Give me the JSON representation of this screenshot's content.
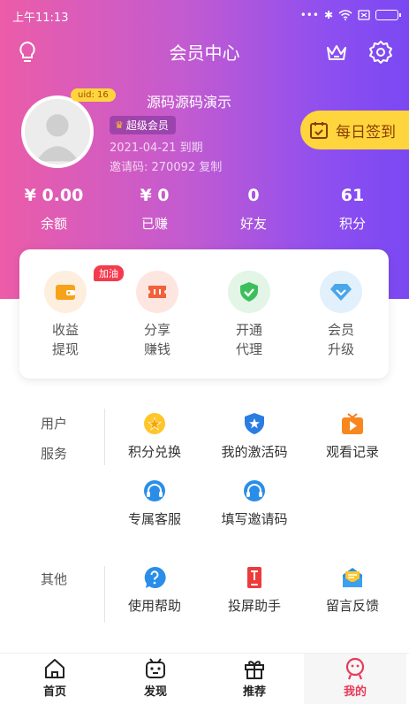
{
  "status_bar": {
    "time": "上午11:13",
    "icons": [
      "signal-dots-icon",
      "bluetooth-icon",
      "wifi-icon",
      "sim-icon",
      "battery-icon"
    ]
  },
  "nav": {
    "title": "会员中心",
    "left_icon": "lightbulb-icon",
    "right_icons": [
      "crown-icon",
      "gear-icon"
    ]
  },
  "profile": {
    "uid": "uid: 16",
    "username": "源码源码演示",
    "vip_level": "超级会员",
    "expire": "2021-04-21 到期",
    "invite_code": "邀请码: 270092 复制",
    "checkin_label": "每日签到"
  },
  "stats": [
    {
      "value": "¥ 0.00",
      "label": "余额"
    },
    {
      "value": "¥ 0",
      "label": "已赚"
    },
    {
      "value": "0",
      "label": "好友"
    },
    {
      "value": "61",
      "label": "积分"
    }
  ],
  "actions": [
    {
      "line1": "收益",
      "line2": "提现",
      "icon": "wallet-icon",
      "badge": "加油"
    },
    {
      "line1": "分享",
      "line2": "赚钱",
      "icon": "ticket-icon"
    },
    {
      "line1": "开通",
      "line2": "代理",
      "icon": "shield-check-icon"
    },
    {
      "line1": "会员",
      "line2": "升级",
      "icon": "diamond-icon"
    }
  ],
  "sections": {
    "user_services": {
      "label_line1": "用户",
      "label_line2": "服务",
      "items": [
        {
          "label": "积分兑换",
          "icon": "star-icon"
        },
        {
          "label": "我的激活码",
          "icon": "badge-star-icon"
        },
        {
          "label": "观看记录",
          "icon": "play-icon"
        },
        {
          "label": "专属客服",
          "icon": "headset-icon"
        },
        {
          "label": "填写邀请码",
          "icon": "headset-icon"
        }
      ]
    },
    "other": {
      "label": "其他",
      "items": [
        {
          "label": "使用帮助",
          "icon": "help-icon"
        },
        {
          "label": "投屏助手",
          "icon": "cast-icon"
        },
        {
          "label": "留言反馈",
          "icon": "mail-icon"
        }
      ]
    }
  },
  "bottom_nav": [
    {
      "label": "首页",
      "icon": "home-icon"
    },
    {
      "label": "发现",
      "icon": "robot-icon"
    },
    {
      "label": "推荐",
      "icon": "gift-icon"
    },
    {
      "label": "我的",
      "icon": "profile-face-icon",
      "active": true
    }
  ],
  "colors": {
    "gradient_start": "#ec5ca8",
    "gradient_end": "#7a48f2",
    "accent_yellow": "#ffd53d",
    "active_tab": "#e83a5a"
  }
}
